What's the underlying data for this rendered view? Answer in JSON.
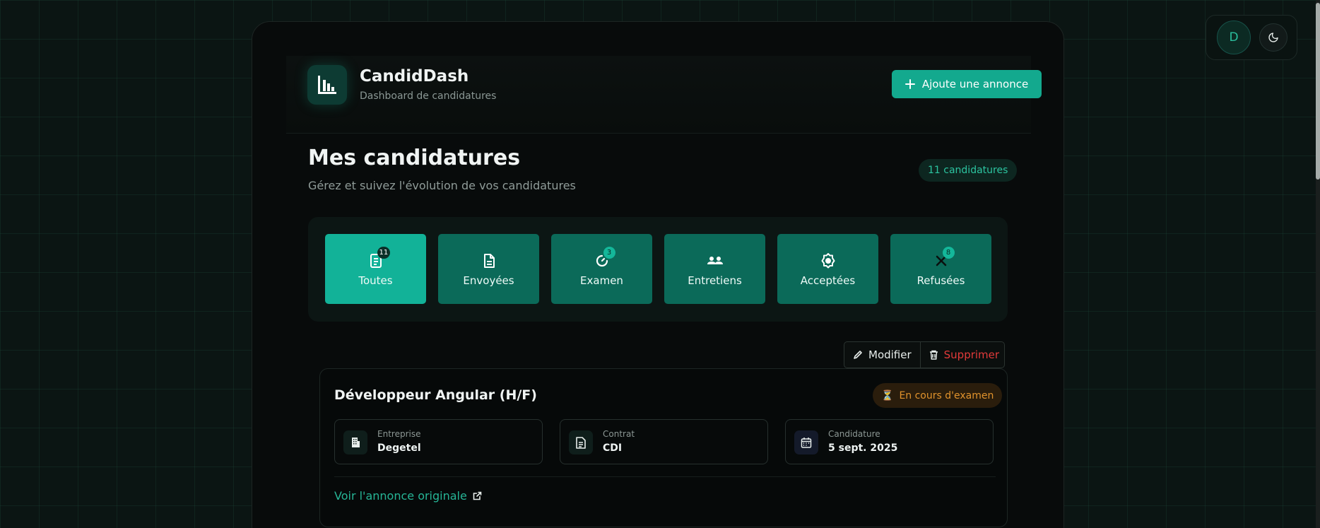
{
  "user": {
    "avatar_initial": "D"
  },
  "header": {
    "app_title": "CandidDash",
    "app_subtitle": "Dashboard de candidatures",
    "add_button_label": "Ajoute une annonce"
  },
  "page": {
    "title": "Mes candidatures",
    "subtitle": "Gérez et suivez l'évolution de vos candidatures",
    "count_label": "11 candidatures"
  },
  "filters": [
    {
      "label": "Toutes",
      "badge": "11",
      "icon": "document-icon",
      "active": true
    },
    {
      "label": "Envoyées",
      "badge": "",
      "icon": "file-icon",
      "active": false
    },
    {
      "label": "Examen",
      "badge": "3",
      "icon": "progress-icon",
      "active": false
    },
    {
      "label": "Entretiens",
      "badge": "",
      "icon": "users-icon",
      "active": false
    },
    {
      "label": "Acceptées",
      "badge": "",
      "icon": "badge-check-icon",
      "active": false
    },
    {
      "label": "Refusées",
      "badge": "8",
      "icon": "x-icon",
      "active": false
    }
  ],
  "actions": {
    "edit_label": "Modifier",
    "delete_label": "Supprimer"
  },
  "card": {
    "title": "Développeur Angular (H/F)",
    "status": "En cours d'examen",
    "company_label": "Entreprise",
    "company_value": "Degetel",
    "contract_label": "Contrat",
    "contract_value": "CDI",
    "applied_label": "Candidature",
    "applied_value": "5 sept. 2025",
    "link_label": "Voir l'annonce originale"
  },
  "colors": {
    "accent": "#13a98e",
    "filter_bg": "#0b6a59",
    "filter_active": "#12b298",
    "danger": "#e23a3a",
    "warning": "#e0922c"
  }
}
